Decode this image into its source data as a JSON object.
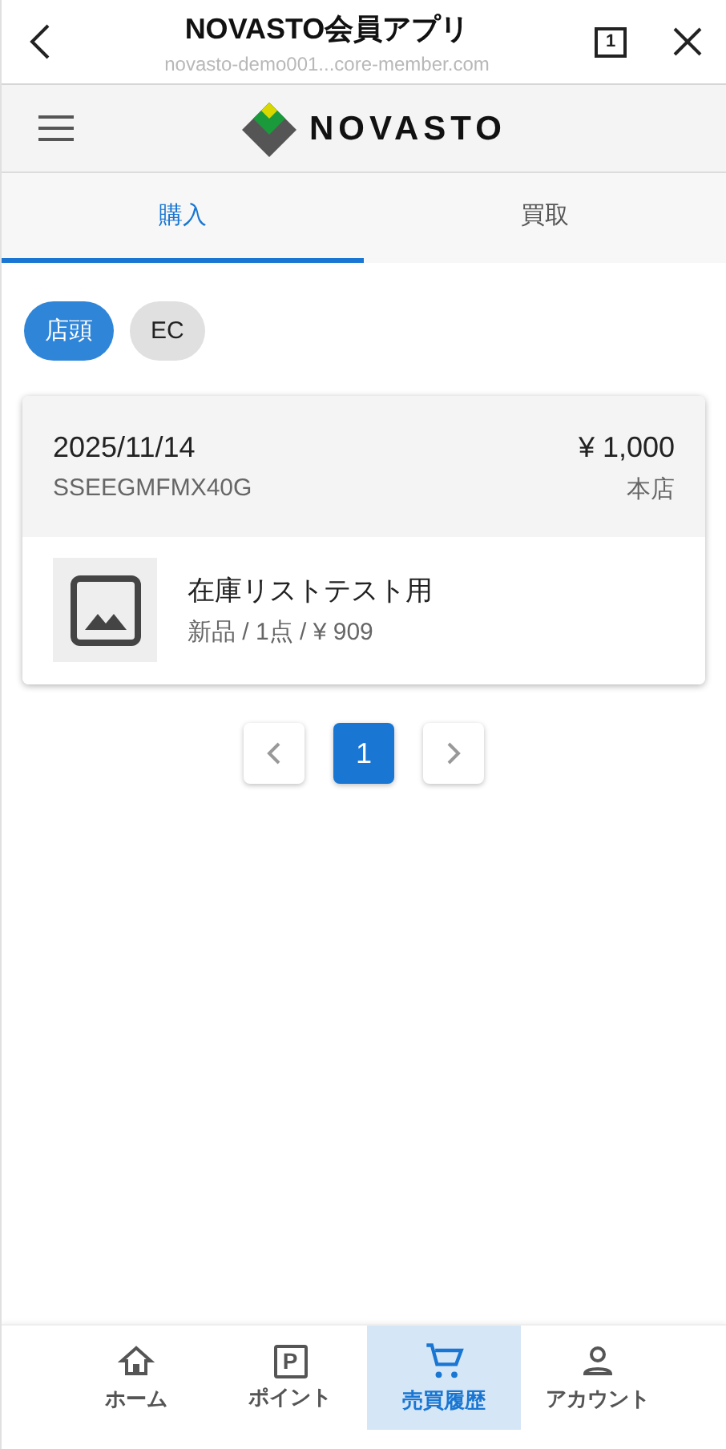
{
  "browser": {
    "title": "NOVASTO会員アプリ",
    "url": "novasto-demo001...core-member.com",
    "tab_count": "1"
  },
  "app_bar": {
    "logo_text": "NOVASTO"
  },
  "tabs": [
    {
      "label": "購入",
      "selected": true
    },
    {
      "label": "買取",
      "selected": false
    }
  ],
  "chips": [
    {
      "label": "店頭",
      "selected": true
    },
    {
      "label": "EC",
      "selected": false
    }
  ],
  "orders": [
    {
      "date": "2025/11/14",
      "code": "SSEEGMFMX40G",
      "total": "¥ 1,000",
      "store": "本店",
      "items": [
        {
          "name": "在庫リストテスト用",
          "detail": "新品 / 1点 / ¥ 909"
        }
      ]
    }
  ],
  "pagination": {
    "pages": [
      {
        "label": "1",
        "selected": true
      }
    ]
  },
  "bottom_nav": [
    {
      "kind": "home",
      "label": "ホーム",
      "selected": false
    },
    {
      "kind": "points",
      "label": "ポイント",
      "icon_letter": "P",
      "selected": false
    },
    {
      "kind": "cart",
      "label": "売買履歴",
      "selected": true
    },
    {
      "kind": "account",
      "label": "アカウント",
      "selected": false
    }
  ]
}
